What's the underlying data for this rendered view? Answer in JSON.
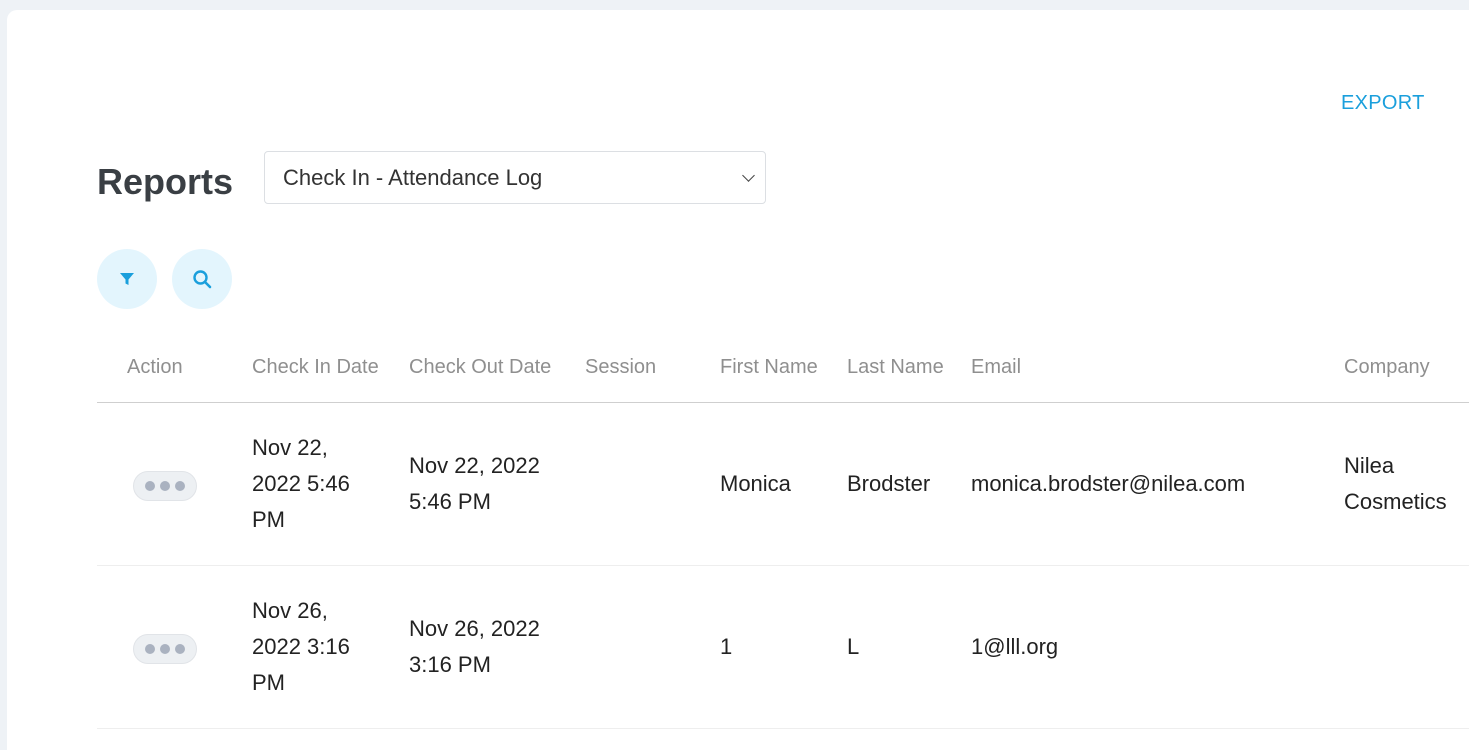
{
  "header": {
    "export_label": "EXPORT",
    "title": "Reports",
    "report_select": {
      "selected": "Check In - Attendance Log"
    }
  },
  "toolbar": {
    "filter_icon": "filter-icon",
    "search_icon": "search-icon"
  },
  "colors": {
    "accent": "#1a9fdc",
    "icon_button_bg": "#e3f5fd",
    "page_bg": "#eef2f6"
  },
  "table": {
    "columns": [
      "Action",
      "Check In Date",
      "Check Out Date",
      "Session",
      "First Name",
      "Last Name",
      "Email",
      "Company"
    ],
    "rows": [
      {
        "check_in": "Nov 22, 2022 5:46 PM",
        "check_out": "Nov 22, 2022 5:46 PM",
        "session": "",
        "first_name": "Monica",
        "last_name": "Brodster",
        "email": "monica.brodster@nilea.com",
        "company": "Nilea Cosmetics"
      },
      {
        "check_in": "Nov 26, 2022 3:16 PM",
        "check_out": "Nov 26, 2022 3:16 PM",
        "session": "",
        "first_name": "1",
        "last_name": "L",
        "email": "1@lll.org",
        "company": ""
      }
    ]
  }
}
